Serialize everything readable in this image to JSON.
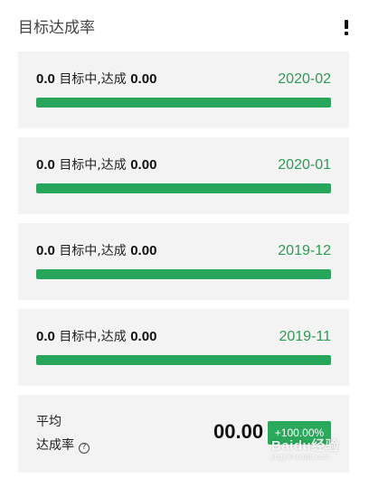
{
  "header": {
    "title": "目标达成率",
    "menu_icon": "exclamation-icon"
  },
  "cards": [
    {
      "actual": "0.0",
      "mid_text": "目标中,达成",
      "goal": "0.00",
      "month": "2020-02",
      "progress": 1.0
    },
    {
      "actual": "0.0",
      "mid_text": "目标中,达成",
      "goal": "0.00",
      "month": "2020-01",
      "progress": 1.0
    },
    {
      "actual": "0.0",
      "mid_text": "目标中,达成",
      "goal": "0.00",
      "month": "2019-12",
      "progress": 1.0
    },
    {
      "actual": "0.0",
      "mid_text": "目标中,达成",
      "goal": "0.00",
      "month": "2019-11",
      "progress": 1.0
    }
  ],
  "average": {
    "label_line1": "平均",
    "label_line2": "达成率",
    "value": "00.00",
    "badge": "+100.00%",
    "help_icon": "question-circle-icon"
  },
  "watermark": {
    "text": "Baidu经验",
    "sub": "jingyan.baidu.com"
  },
  "colors": {
    "accent": "#27a55a",
    "date": "#2e9a55",
    "card_bg": "#f3f3f3"
  }
}
